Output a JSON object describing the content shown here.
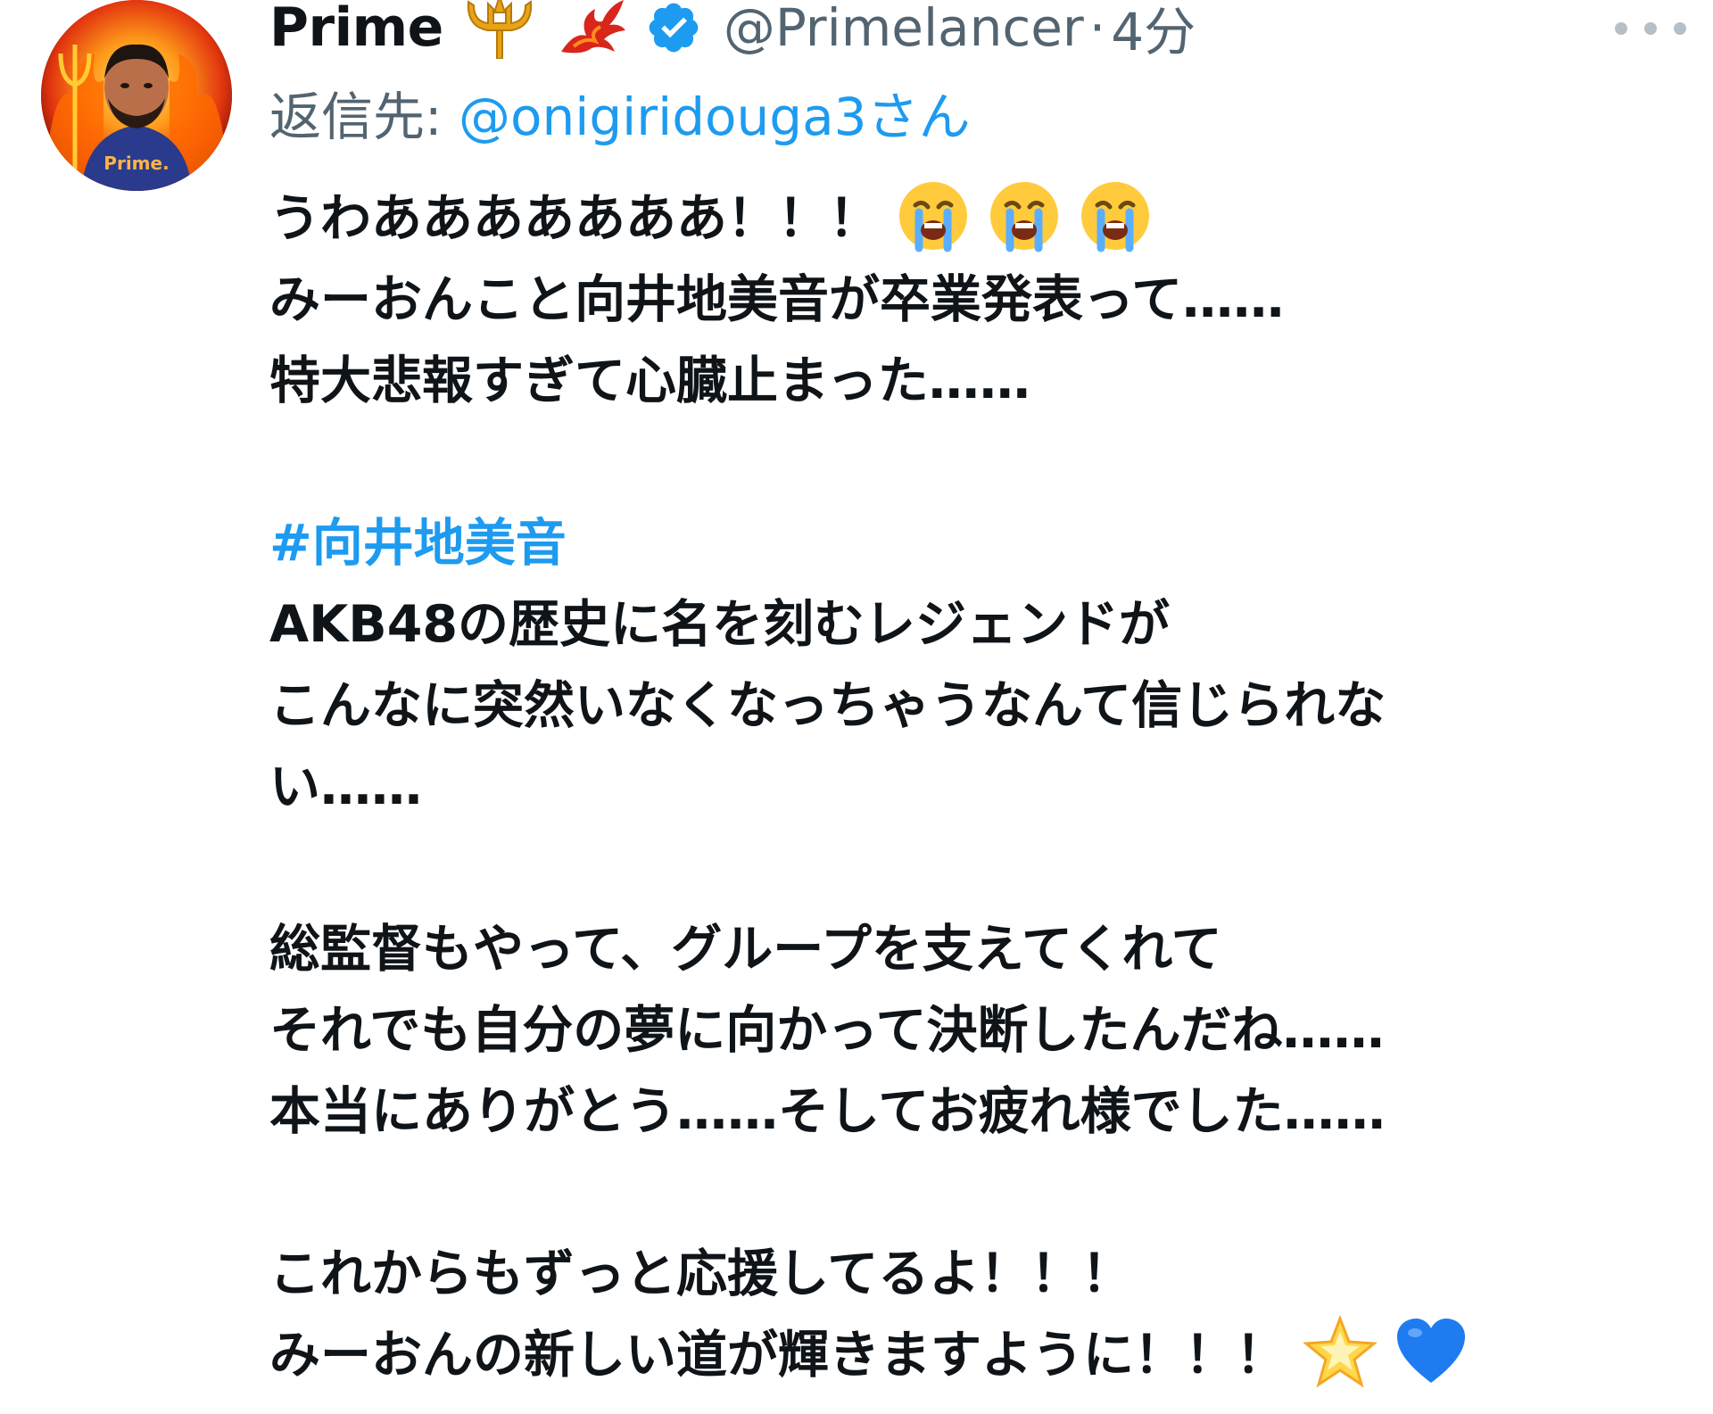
{
  "tweet": {
    "display_name": "Prime",
    "name_icons": [
      "trident-icon",
      "phoenix-icon",
      "verified-badge-icon"
    ],
    "handle": "@Primelancer",
    "separator": "·",
    "time": "4分",
    "avatar_text": "Prime.",
    "reply_to": {
      "prefix": "返信先: ",
      "handle": "@onigiridouga3",
      "suffix": "さん"
    },
    "lines": {
      "l1": "うわあああああああ！！！",
      "l2": "みーおんこと向井地美音が卒業発表って……",
      "l3": "特大悲報すぎて心臓止まった……",
      "hashtag": "#向井地美音",
      "l5": "AKB48の歴史に名を刻むレジェンドが",
      "l6": "こんなに突然いなくなっちゃうなんて信じられな",
      "l7": "い……",
      "l8": "総監督もやって、グループを支えてくれて",
      "l9": "それでも自分の夢に向かって決断したんだね……",
      "l10": "本当にありがとう……そしてお疲れ様でした……",
      "l11": "これからもずっと応援してるよ！！！",
      "l12": "みーおんの新しい道が輝きますように！！！"
    },
    "emojis": {
      "line1": [
        "loudly-crying-face-icon",
        "loudly-crying-face-icon",
        "loudly-crying-face-icon"
      ],
      "line12": [
        "glowing-star-icon",
        "blue-heart-icon"
      ]
    },
    "colors": {
      "link": "#1d9bf0",
      "secondary_text": "#536471",
      "primary_text": "#0f1419",
      "verified": "#1d9bf0"
    }
  }
}
